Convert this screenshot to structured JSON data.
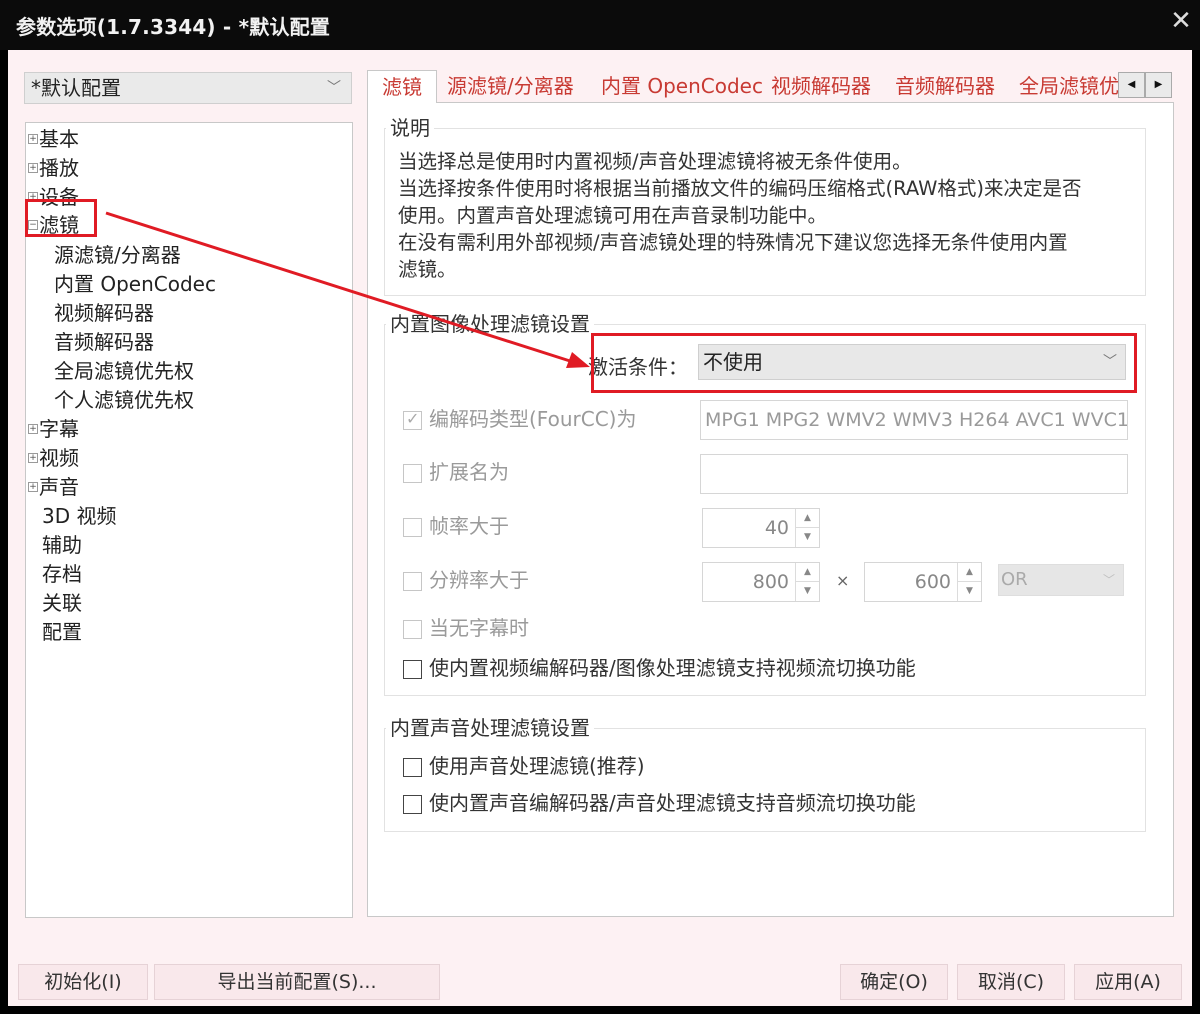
{
  "window": {
    "title": "参数选项(1.7.3344) - *默认配置",
    "close_glyph": "✕"
  },
  "profile": {
    "value": "*默认配置"
  },
  "tree": {
    "items": [
      {
        "label": "基本",
        "expander": "+"
      },
      {
        "label": "播放",
        "expander": "+"
      },
      {
        "label": "设备",
        "expander": "+"
      },
      {
        "label": "滤镜",
        "expander": "−"
      },
      {
        "label": "源滤镜/分离器",
        "expander": ""
      },
      {
        "label": "内置 OpenCodec",
        "expander": ""
      },
      {
        "label": "视频解码器",
        "expander": ""
      },
      {
        "label": "音频解码器",
        "expander": ""
      },
      {
        "label": "全局滤镜优先权",
        "expander": ""
      },
      {
        "label": "个人滤镜优先权",
        "expander": ""
      },
      {
        "label": "字幕",
        "expander": "+"
      },
      {
        "label": "视频",
        "expander": "+"
      },
      {
        "label": "声音",
        "expander": "+"
      },
      {
        "label": "3D 视频",
        "expander": ""
      },
      {
        "label": "辅助",
        "expander": ""
      },
      {
        "label": "存档",
        "expander": ""
      },
      {
        "label": "关联",
        "expander": ""
      },
      {
        "label": "配置",
        "expander": ""
      }
    ]
  },
  "tabs": [
    {
      "label": "滤镜"
    },
    {
      "label": "源滤镜/分离器"
    },
    {
      "label": "内置 OpenCodec"
    },
    {
      "label": "视频解码器"
    },
    {
      "label": "音频解码器"
    },
    {
      "label": "全局滤镜优先权"
    }
  ],
  "tab_scroll": {
    "left": "◀",
    "right": "▶"
  },
  "description": {
    "title": "说明",
    "lines": [
      "当选择总是使用时内置视频/声音处理滤镜将被无条件使用。",
      "当选择按条件使用时将根据当前播放文件的编码压缩格式(RAW格式)来决定是否",
      "使用。内置声音处理滤镜可用在声音录制功能中。",
      "在没有需利用外部视频/声音滤镜处理的特殊情况下建议您选择无条件使用内置",
      "滤镜。"
    ]
  },
  "video_filter": {
    "title": "内置图像处理滤镜设置",
    "activation_label": "激活条件：",
    "activation_value": "不使用",
    "codec_label": "编解码类型(FourCC)为",
    "codec_checked": true,
    "codec_value": "MPG1 MPG2 WMV2 WMV3 H264 AVC1 WVC1",
    "ext_label": "扩展名为",
    "ext_value": "",
    "fps_label": "帧率大于",
    "fps_value": "40",
    "res_label": "分辨率大于",
    "res_w": "800",
    "res_x": "×",
    "res_h": "600",
    "res_op": "OR",
    "nosub_label": "当无字幕时",
    "switch_label": "使内置视频编解码器/图像处理滤镜支持视频流切换功能"
  },
  "audio_filter": {
    "title": "内置声音处理滤镜设置",
    "use_label": "使用声音处理滤镜(推荐)",
    "switch_label": "使内置声音编解码器/声音处理滤镜支持音频流切换功能"
  },
  "buttons": {
    "reset": "初始化(I)",
    "export": "导出当前配置(S)...",
    "ok": "确定(O)",
    "cancel": "取消(C)",
    "apply": "应用(A)"
  },
  "colors": {
    "tab_text": "#c83a33",
    "annotation_red": "#e01b24",
    "client_bg": "#fdf1f3"
  }
}
